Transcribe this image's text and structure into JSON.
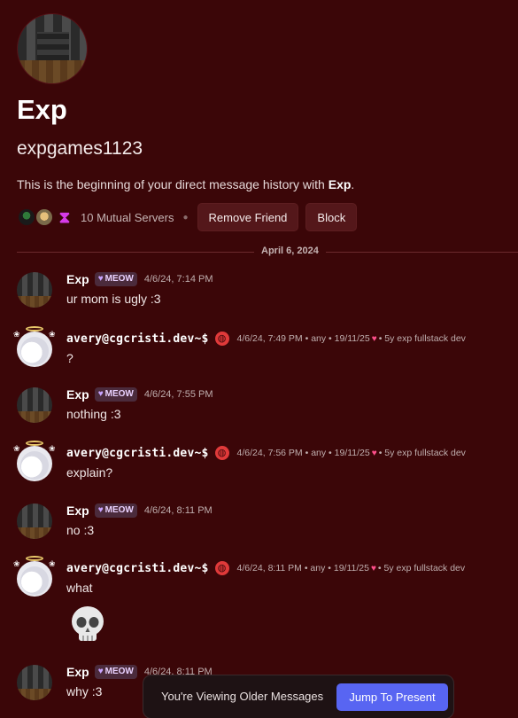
{
  "profile": {
    "display_name": "Exp",
    "username": "expgames1123",
    "intro_prefix": "This is the beginning of your direct message history with ",
    "intro_name": "Exp",
    "intro_suffix": ".",
    "mutual_servers": "10 Mutual Servers",
    "remove_friend_label": "Remove Friend",
    "block_label": "Block"
  },
  "divider": {
    "date": "April 6, 2024"
  },
  "messages": [
    {
      "author": "Exp",
      "tag": "MEOW",
      "timestamp": "4/6/24, 7:14 PM",
      "text": "ur mom is ugly :3"
    },
    {
      "author": "avery@cgcristi.dev~$",
      "timestamp": "4/6/24, 7:49 PM",
      "meta1": "• any • 19/11/25",
      "meta2": "• 5y exp fullstack dev",
      "text": "?"
    },
    {
      "author": "Exp",
      "tag": "MEOW",
      "timestamp": "4/6/24, 7:55 PM",
      "text": "nothing :3"
    },
    {
      "author": "avery@cgcristi.dev~$",
      "timestamp": "4/6/24, 7:56 PM",
      "meta1": "• any • 19/11/25",
      "meta2": "• 5y exp fullstack dev",
      "text": "explain?"
    },
    {
      "author": "Exp",
      "tag": "MEOW",
      "timestamp": "4/6/24, 8:11 PM",
      "text": "no :3"
    },
    {
      "author": "avery@cgcristi.dev~$",
      "timestamp": "4/6/24, 8:11 PM",
      "meta1": "• any • 19/11/25",
      "meta2": "• 5y exp fullstack dev",
      "text": "what"
    },
    {
      "author": "Exp",
      "tag": "MEOW",
      "timestamp": "4/6/24, 8:11 PM",
      "text": "why :3"
    }
  ],
  "toast": {
    "text": "You're Viewing Older Messages",
    "jump_label": "Jump To Present",
    "accent": "#5865f2"
  },
  "colors": {
    "background": "#3b0608"
  }
}
